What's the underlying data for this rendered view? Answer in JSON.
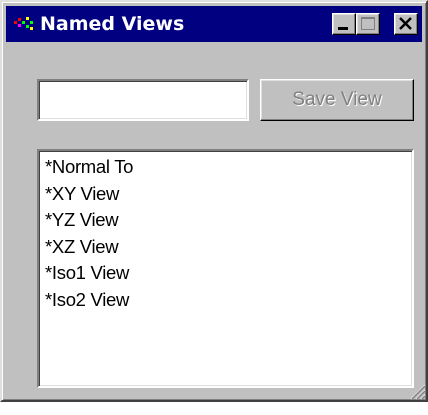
{
  "window": {
    "title": "Named Views",
    "icons": {
      "app": "color-dots-icon",
      "minimize": "minimize-icon",
      "maximize": "maximize-icon",
      "close": "close-icon",
      "resize": "resize-grip-icon"
    }
  },
  "form": {
    "name_value": "",
    "save_label": "Save View",
    "save_enabled": false
  },
  "views": {
    "items": [
      {
        "label": "*Normal To"
      },
      {
        "label": "*XY View"
      },
      {
        "label": "*YZ View"
      },
      {
        "label": "*XZ View"
      },
      {
        "label": "*Iso1 View"
      },
      {
        "label": "*Iso2 View"
      }
    ]
  },
  "colors": {
    "titlebar": "#000080",
    "face": "#c0c0c0",
    "disabled_text": "#808080"
  }
}
